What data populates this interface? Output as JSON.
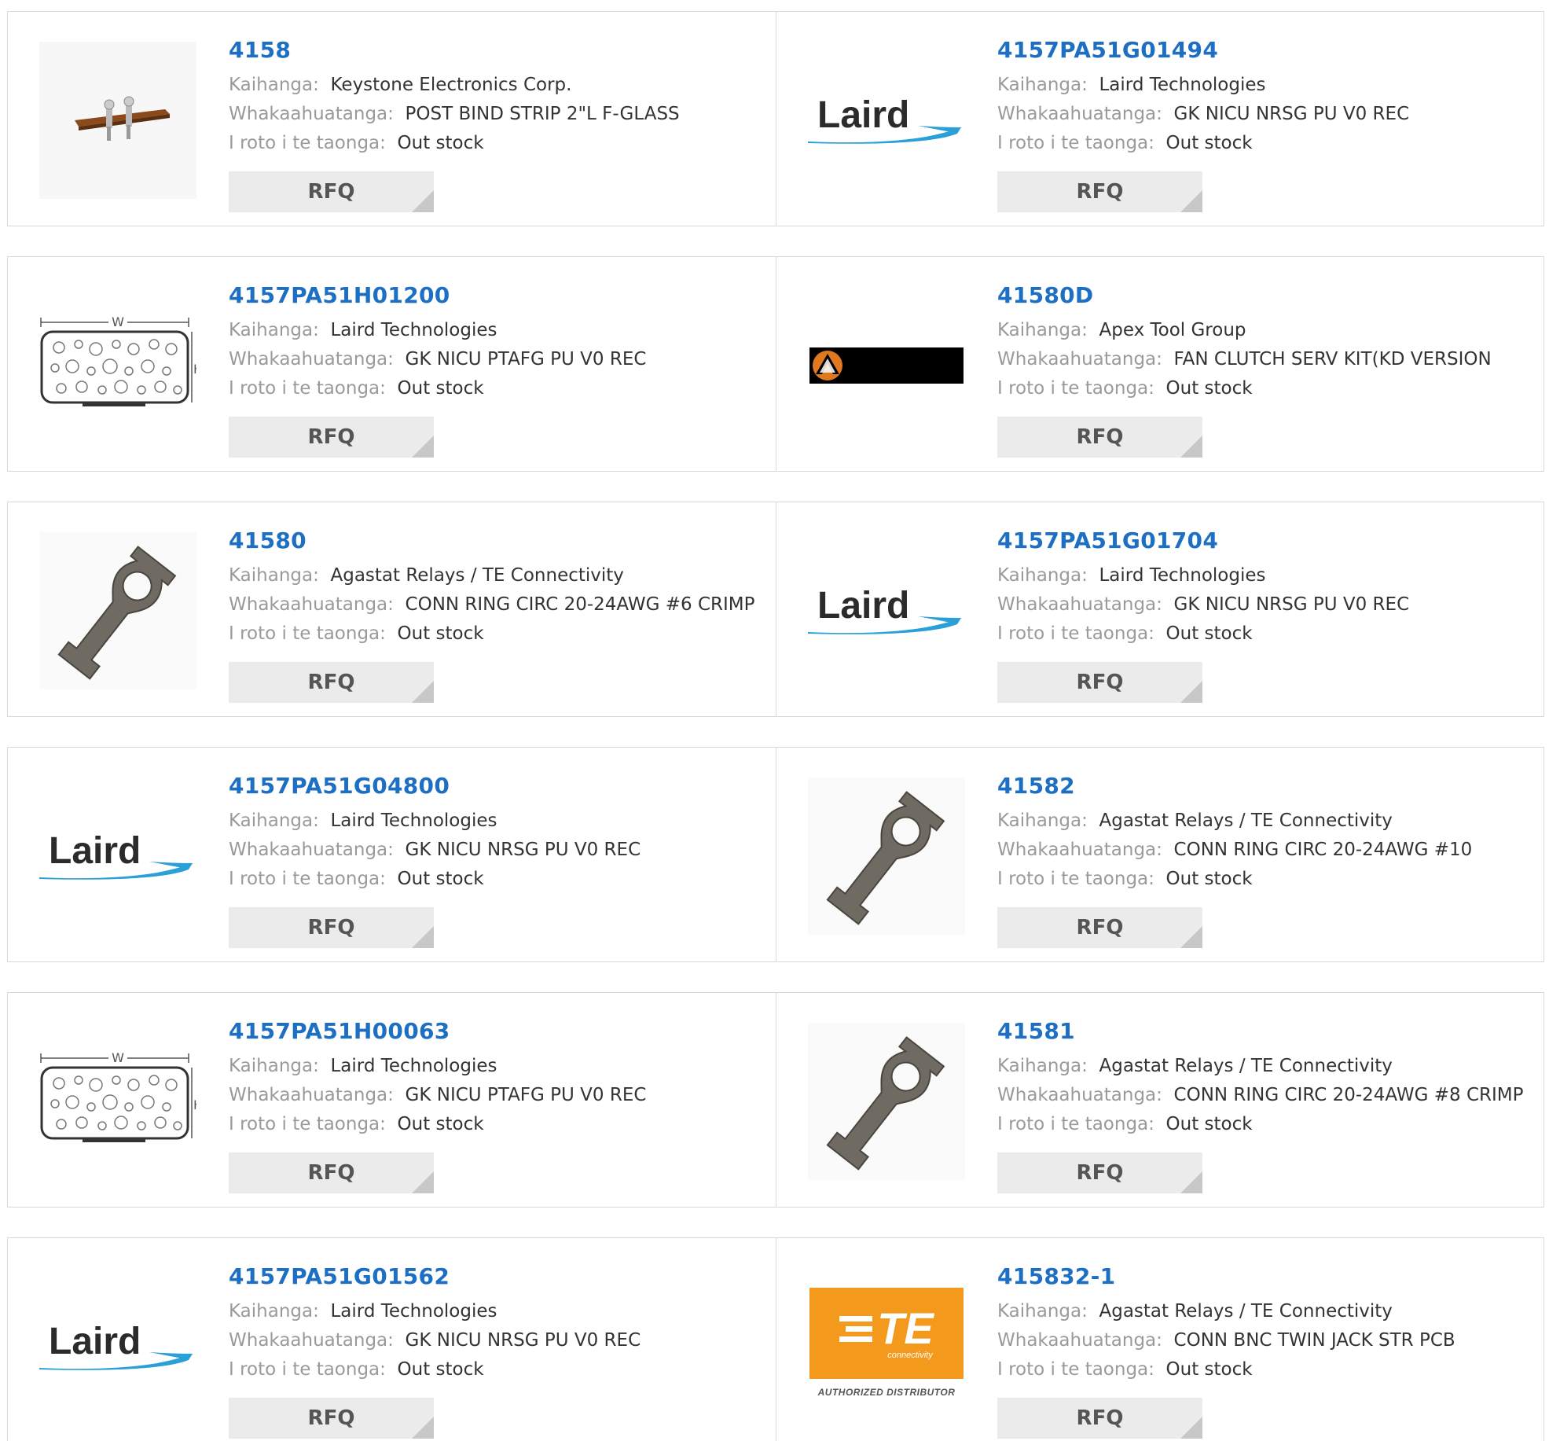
{
  "labels": {
    "manufacturer": "Kaihanga:",
    "description": "Whakaahuatanga:",
    "stock": "I roto i te taonga:",
    "rfq": "RFQ"
  },
  "logos": {
    "laird": "Laird",
    "te": "TE",
    "te_sub": "connectivity",
    "te_authorized": "AUTHORIZED DISTRIBUTOR"
  },
  "colors": {
    "part_link": "#1c6fc2",
    "laird_blue": "#2a9fd8",
    "te_orange": "#f39a1d"
  },
  "rows": [
    {
      "left": {
        "part": "4158",
        "manufacturer": "Keystone Electronics Corp.",
        "description": "POST BIND STRIP 2\"L F-GLASS",
        "stock": "Out stock",
        "image": "binding-post-strip-image"
      },
      "right": {
        "part": "4157PA51G01494",
        "manufacturer": "Laird Technologies",
        "description": "GK NICU NRSG PU V0 REC",
        "stock": "Out stock",
        "image": "laird-logo"
      }
    },
    {
      "left": {
        "part": "4157PA51H01200",
        "manufacturer": "Laird Technologies",
        "description": "GK NICU PTAFG PU V0 REC",
        "stock": "Out stock",
        "image": "gasket-diagram"
      },
      "right": {
        "part": "41580D",
        "manufacturer": "Apex Tool Group",
        "description": "FAN CLUTCH SERV KIT(KD VERSION",
        "stock": "Out stock",
        "image": "apex-logo"
      }
    },
    {
      "left": {
        "part": "41580",
        "manufacturer": "Agastat Relays / TE Connectivity",
        "description": "CONN RING CIRC 20-24AWG #6 CRIMP",
        "stock": "Out stock",
        "image": "ring-terminal-image"
      },
      "right": {
        "part": "4157PA51G01704",
        "manufacturer": "Laird Technologies",
        "description": "GK NICU NRSG PU V0 REC",
        "stock": "Out stock",
        "image": "laird-logo"
      }
    },
    {
      "left": {
        "part": "4157PA51G04800",
        "manufacturer": "Laird Technologies",
        "description": "GK NICU NRSG PU V0 REC",
        "stock": "Out stock",
        "image": "laird-logo"
      },
      "right": {
        "part": "41582",
        "manufacturer": "Agastat Relays / TE Connectivity",
        "description": "CONN RING CIRC 20-24AWG #10",
        "stock": "Out stock",
        "image": "ring-terminal-image"
      }
    },
    {
      "left": {
        "part": "4157PA51H00063",
        "manufacturer": "Laird Technologies",
        "description": "GK NICU PTAFG PU V0 REC",
        "stock": "Out stock",
        "image": "gasket-diagram"
      },
      "right": {
        "part": "41581",
        "manufacturer": "Agastat Relays / TE Connectivity",
        "description": "CONN RING CIRC 20-24AWG #8 CRIMP",
        "stock": "Out stock",
        "image": "ring-terminal-image"
      }
    },
    {
      "left": {
        "part": "4157PA51G01562",
        "manufacturer": "Laird Technologies",
        "description": "GK NICU NRSG PU V0 REC",
        "stock": "Out stock",
        "image": "laird-logo"
      },
      "right": {
        "part": "415832-1",
        "manufacturer": "Agastat Relays / TE Connectivity",
        "description": "CONN BNC TWIN JACK STR PCB",
        "stock": "Out stock",
        "image": "te-logo"
      }
    }
  ]
}
